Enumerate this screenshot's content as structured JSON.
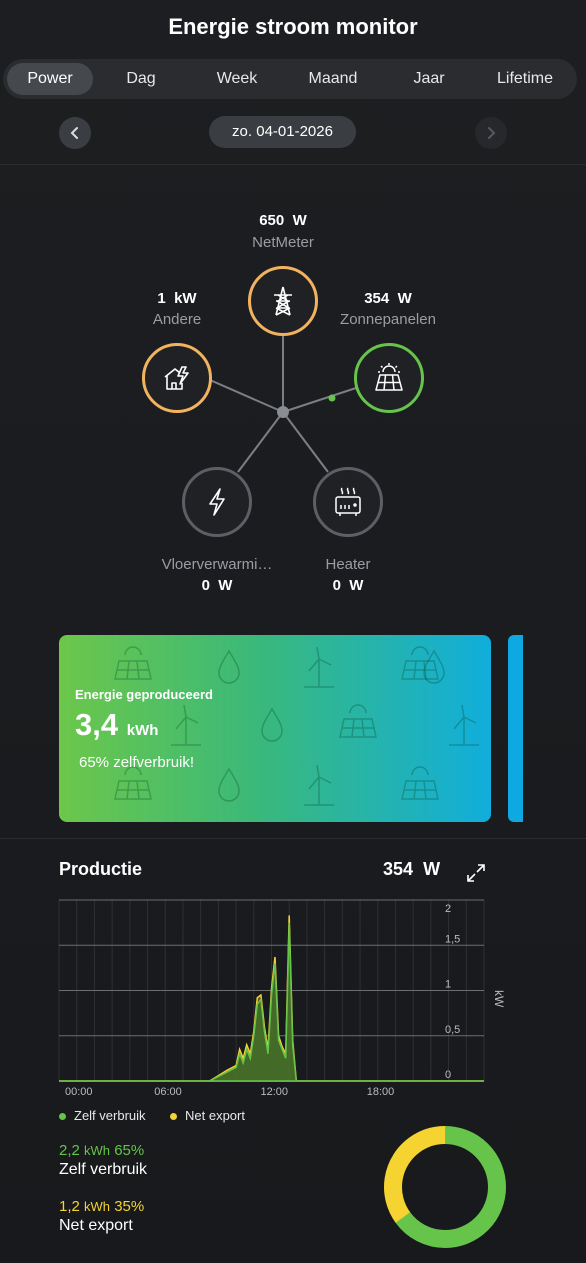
{
  "app_title": "Energie stroom monitor",
  "tabs": [
    {
      "label": "Power",
      "active": true
    },
    {
      "label": "Dag",
      "active": false
    },
    {
      "label": "Week",
      "active": false
    },
    {
      "label": "Maand",
      "active": false
    },
    {
      "label": "Jaar",
      "active": false
    },
    {
      "label": "Lifetime",
      "active": false
    }
  ],
  "date": "zo. 04-01-2026",
  "flow": {
    "netmeter": {
      "value": "650",
      "unit": "W",
      "label": "NetMeter",
      "icon": "power-tower-icon",
      "color": "#f2b35e"
    },
    "andere": {
      "value": "1",
      "unit": "kW",
      "label": "Andere",
      "icon": "house-lightning-icon",
      "color": "#f2b35e"
    },
    "zonnepanelen": {
      "value": "354",
      "unit": "W",
      "label": "Zonnepanelen",
      "icon": "solar-panel-icon",
      "color": "#66c44a"
    },
    "vloerverwarming": {
      "value": "0",
      "unit": "W",
      "label": "Vloerverwarmi…",
      "icon": "lightning-icon",
      "color": "#5c5f64"
    },
    "heater": {
      "value": "0",
      "unit": "W",
      "label": "Heater",
      "icon": "heater-icon",
      "color": "#5c5f64"
    }
  },
  "card": {
    "title": "Energie geproduceerd",
    "value": "3,4",
    "unit": "kWh",
    "subtitle": "65% zelfverbruik!"
  },
  "production": {
    "title": "Productie",
    "value": "354",
    "unit": "W",
    "expand_icon": "expand-icon"
  },
  "chart_data": {
    "type": "area",
    "ylabel": "kW",
    "ylim": [
      0,
      2
    ],
    "yticks": [
      "2",
      "1,5",
      "1",
      "0,5",
      "0"
    ],
    "xticks": [
      "00:00",
      "06:00",
      "12:00",
      "18:00"
    ],
    "x_hours": [
      0,
      8.5,
      9.0,
      9.5,
      10.0,
      10.2,
      10.4,
      10.6,
      10.8,
      11.0,
      11.2,
      11.4,
      11.6,
      11.8,
      12.0,
      12.2,
      12.4,
      12.6,
      12.8,
      13.0,
      13.2,
      13.4,
      13.6,
      13.8,
      24
    ],
    "series": [
      {
        "name": "Zelf verbruik",
        "color": "#66c44a",
        "values": [
          0,
          0,
          0.05,
          0.1,
          0.15,
          0.3,
          0.2,
          0.35,
          0.25,
          0.5,
          0.85,
          0.9,
          0.55,
          0.3,
          0.95,
          1.3,
          0.45,
          0.35,
          0.25,
          1.75,
          0.4,
          0,
          0,
          0,
          0
        ]
      },
      {
        "name": "Net export",
        "color": "#f5d330",
        "values": [
          0,
          0,
          0.06,
          0.12,
          0.17,
          0.35,
          0.25,
          0.4,
          0.3,
          0.55,
          0.92,
          0.95,
          0.6,
          0.35,
          1.02,
          1.37,
          0.5,
          0.38,
          0.3,
          1.83,
          0.45,
          0,
          0,
          0,
          0
        ]
      }
    ]
  },
  "legend": [
    {
      "label": "Zelf verbruik",
      "color": "#66c44a"
    },
    {
      "label": "Net export",
      "color": "#f5d330"
    }
  ],
  "stats": [
    {
      "amount": "2,2",
      "unit": "kWh",
      "percent": "65%",
      "label": "Zelf verbruik",
      "color": "#66c44a"
    },
    {
      "amount": "1,2",
      "unit": "kWh",
      "percent": "35%",
      "label": "Net export",
      "color": "#f5d330"
    }
  ],
  "donut": {
    "self_fraction": 0.65,
    "export_fraction": 0.35
  }
}
